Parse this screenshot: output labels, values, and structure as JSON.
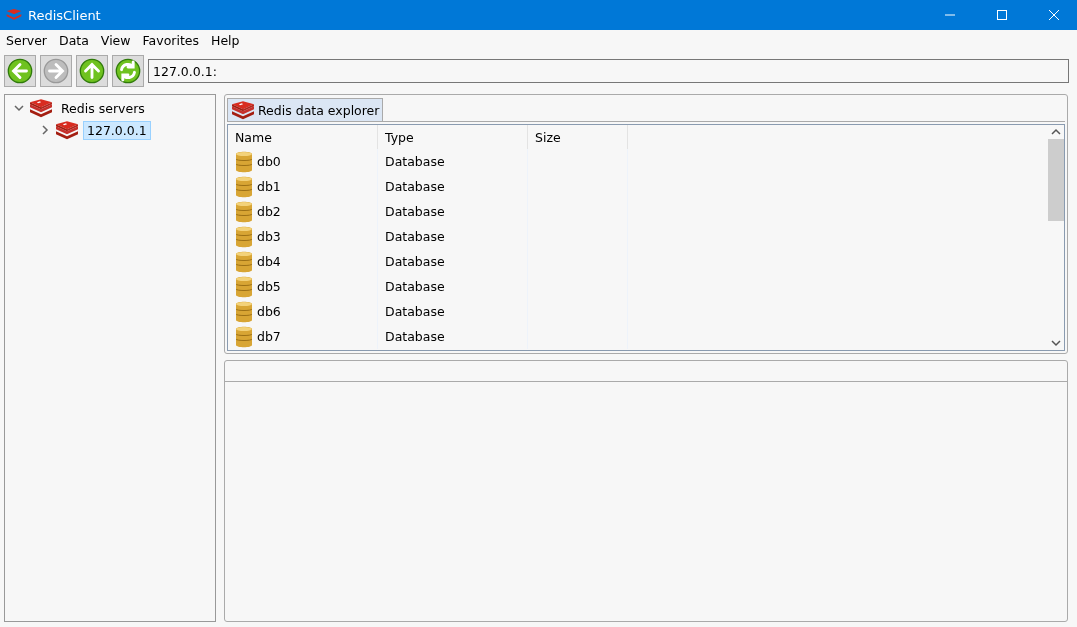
{
  "window": {
    "title": "RedisClient"
  },
  "menu": [
    "Server",
    "Data",
    "View",
    "Favorites",
    "Help"
  ],
  "toolbar": {
    "buttons": [
      {
        "kind": "back",
        "disabled": false
      },
      {
        "kind": "forward",
        "disabled": true
      },
      {
        "kind": "up",
        "disabled": false
      },
      {
        "kind": "refresh",
        "disabled": false
      }
    ],
    "address": "127.0.0.1:"
  },
  "tree": [
    {
      "label": "Redis servers",
      "expanded": true,
      "selected": false,
      "children": [
        {
          "label": "127.0.0.1",
          "expanded": false,
          "selected": true
        }
      ]
    }
  ],
  "tabs": [
    {
      "label": "Redis data explorer",
      "selected": true
    }
  ],
  "table": {
    "columns": [
      "Name",
      "Type",
      "Size"
    ],
    "rows": [
      {
        "name": "db0",
        "type": "Database"
      },
      {
        "name": "db1",
        "type": "Database"
      },
      {
        "name": "db2",
        "type": "Database"
      },
      {
        "name": "db3",
        "type": "Database"
      },
      {
        "name": "db4",
        "type": "Database"
      },
      {
        "name": "db5",
        "type": "Database"
      },
      {
        "name": "db6",
        "type": "Database"
      },
      {
        "name": "db7",
        "type": "Database"
      }
    ]
  }
}
